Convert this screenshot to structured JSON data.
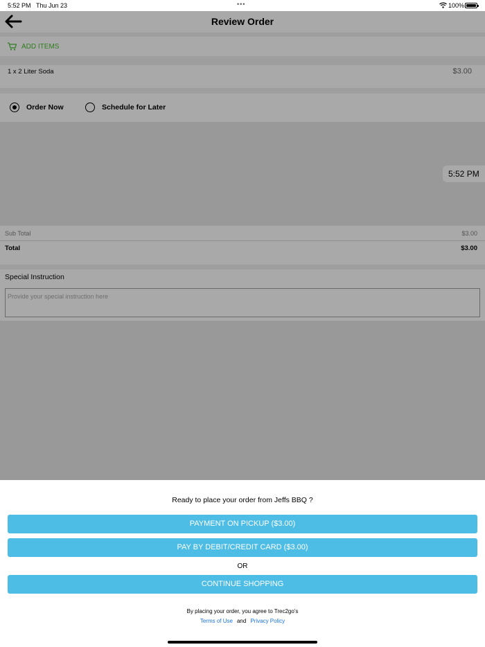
{
  "status_bar": {
    "time": "5:52 PM",
    "date": "Thu Jun 23",
    "dots": "•••",
    "battery": "100%"
  },
  "nav": {
    "title": "Review Order"
  },
  "add_items": {
    "label": "ADD ITEMS"
  },
  "order_items": [
    {
      "name": "1 x 2 Liter Soda",
      "price": "$3.00"
    }
  ],
  "order_type": {
    "options": [
      {
        "label": "Order Now",
        "selected": true
      },
      {
        "label": "Schedule for Later",
        "selected": false
      }
    ]
  },
  "pickup_time": "5:52 PM",
  "totals": {
    "subtotal_label": "Sub Total",
    "subtotal_value": "$3.00",
    "total_label": "Total",
    "total_value": "$3.00"
  },
  "special_instruction": {
    "label": "Special Instruction",
    "placeholder": "Provide your special instruction here",
    "value": ""
  },
  "sheet": {
    "question": "Ready to place your order from Jeffs BBQ ?",
    "pickup_button": "PAYMENT ON PICKUP ($3.00)",
    "card_button": "PAY BY DEBIT/CREDIT CARD ($3.00)",
    "or_label": "OR",
    "continue_button": "CONTINUE SHOPPING",
    "agree_text": "By placing your order, you agree to Trec2go's",
    "terms_link": "Terms of Use",
    "and_text": "and",
    "privacy_link": "Privacy Policy"
  },
  "colors": {
    "button": "#4ebde6",
    "add_items": "#2e7d1f",
    "link": "#1a73e8",
    "overlay": "#999999"
  }
}
